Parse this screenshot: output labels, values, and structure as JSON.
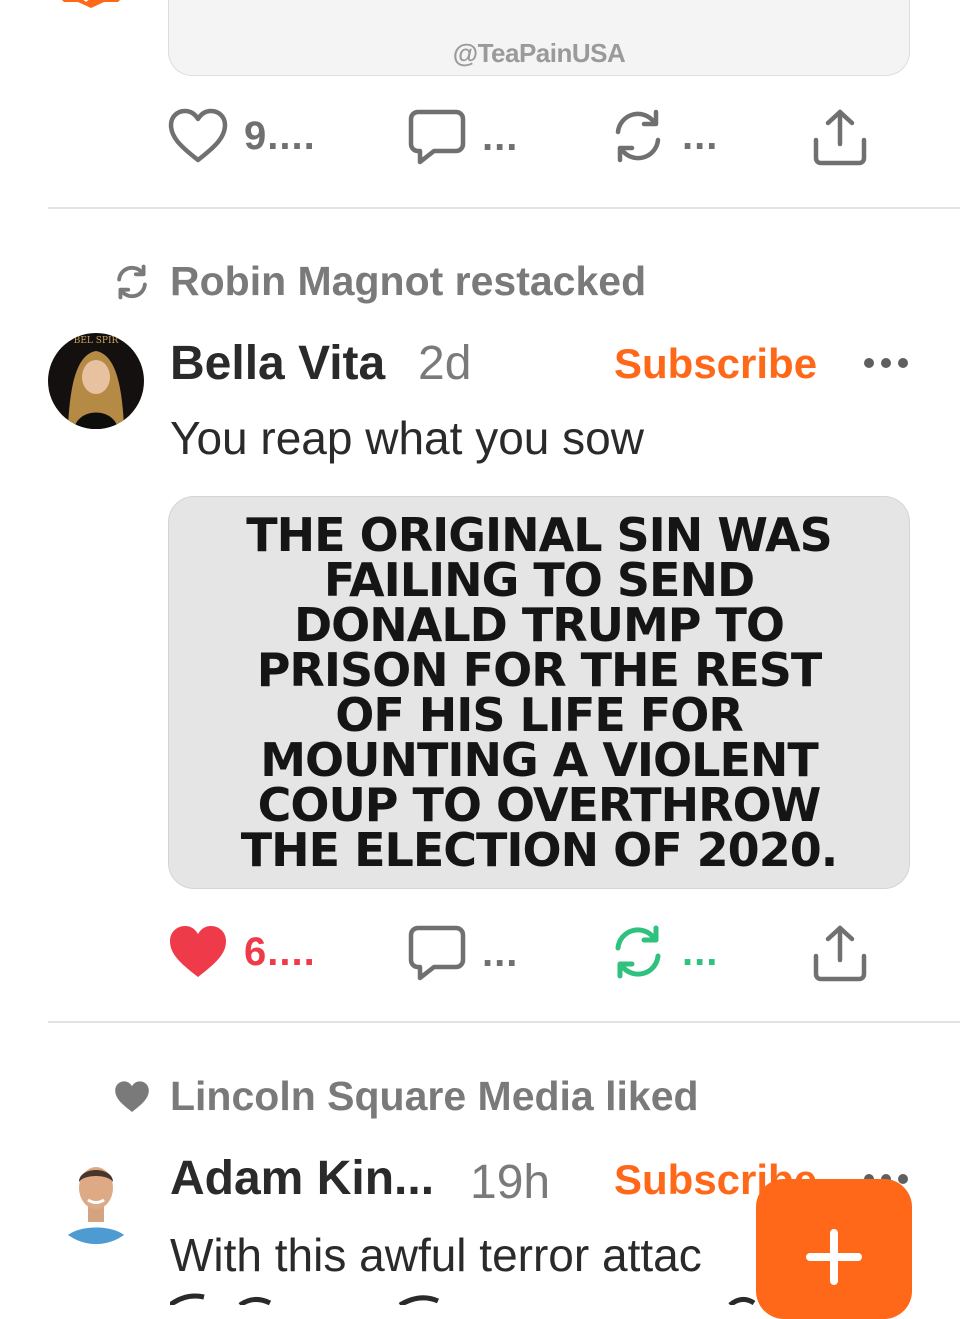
{
  "colors": {
    "accent": "#ff6719",
    "liked": "#ef3a4a",
    "restacked": "#2ec27e",
    "muted": "#7a7a7a"
  },
  "prev_post": {
    "watermark": "@TeaPainUSA",
    "actions": {
      "like_count": "9....",
      "comment_count": "...",
      "restack_count": "..."
    }
  },
  "post1": {
    "context_icon": "restack-icon",
    "context": "Robin Magnot restacked",
    "author": "Bella Vita",
    "time": "2d",
    "subscribe": "Subscribe",
    "text": "You reap what you sow",
    "image_lines": [
      "THE ORIGINAL SIN WAS",
      "FAILING TO SEND",
      "DONALD TRUMP TO",
      "PRISON FOR THE REST",
      "OF HIS LIFE FOR",
      "MOUNTING A VIOLENT",
      "COUP TO OVERTHROW",
      "THE ELECTION OF 2020."
    ],
    "actions": {
      "like_count": "6....",
      "comment_count": "...",
      "restack_count": "...",
      "liked": true,
      "restacked": true
    }
  },
  "post2": {
    "context_icon": "heart-icon",
    "context": "Lincoln Square Media liked",
    "author": "Adam Kin...",
    "time": "19h",
    "subscribe": "Subscribe",
    "text": "With this awful terror attac"
  },
  "fab": {
    "icon": "plus-icon"
  }
}
